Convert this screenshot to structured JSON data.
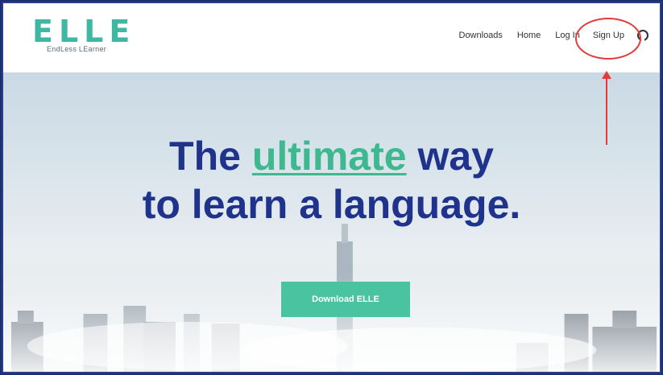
{
  "nav": {
    "logo_text": "ELLE",
    "logo_subtitle": "EndLess LEarner",
    "links": [
      {
        "label": "Downloads"
      },
      {
        "label": "Home"
      },
      {
        "label": "Log In"
      },
      {
        "label": "Sign Up"
      }
    ],
    "github_icon": "github-icon"
  },
  "hero": {
    "title_part1": "The",
    "title_accent": "ultimate",
    "title_part2": "way",
    "title_line2": "to learn a language.",
    "download_button": "Download ELLE"
  },
  "annotation": {
    "color": "#e53a3a",
    "target": "Sign Up"
  },
  "colors": {
    "brand_teal": "#3eb7a3",
    "title_blue": "#20338c",
    "button_green": "#49c3a0"
  }
}
